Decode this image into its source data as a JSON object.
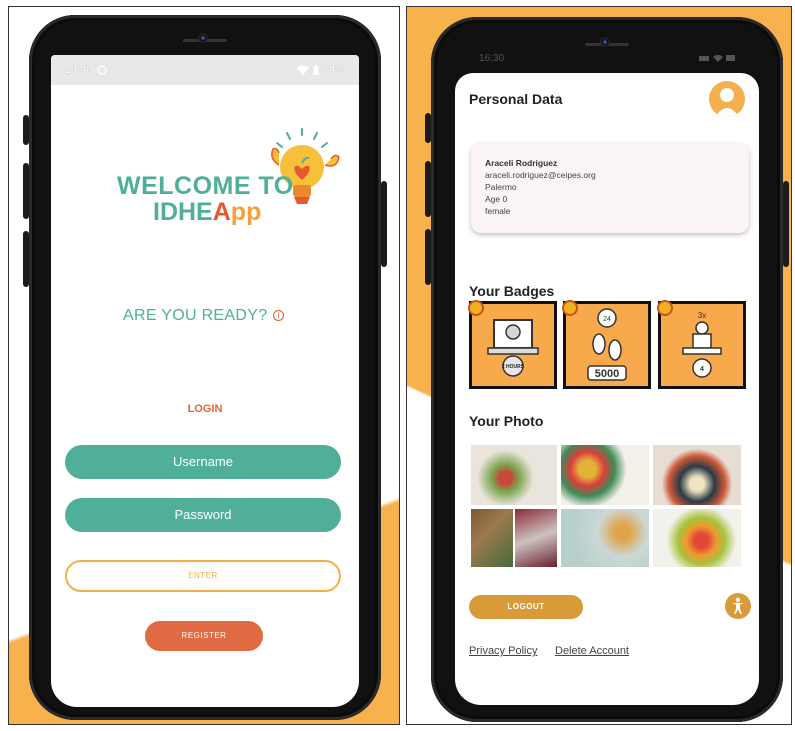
{
  "left_screen": {
    "status_time": "14:48",
    "status_battery": "84%",
    "welcome_line1": "WELCOME TO",
    "app_name_part1": "IDHE",
    "app_name_part2": "A",
    "app_name_part3": "pp",
    "ready_text": "ARE YOU READY?",
    "info_symbol": "i",
    "login_label": "LOGIN",
    "username_placeholder": "Username",
    "password_placeholder": "Password",
    "enter_label": "ENTER",
    "register_label": "REGISTER"
  },
  "right_screen": {
    "status_time": "16:30",
    "personal_data_title": "Personal Data",
    "profile": {
      "name": "Araceli Rodriguez",
      "email": "araceli.rodriguez@ceipes.org",
      "city": "Palermo",
      "age": "Age 0",
      "gender": "female"
    },
    "badges_title": "Your Badges",
    "badges": [
      {
        "icon": "computer-hours-badge-icon",
        "text": "2 HOURS"
      },
      {
        "icon": "steps-badge-icon",
        "text": "5000"
      },
      {
        "icon": "sitting-badge-icon",
        "text": "4"
      }
    ],
    "photos_title": "Your Photo",
    "logout_label": "LOGOUT",
    "privacy_label": "Privacy Policy",
    "delete_label": "Delete Account"
  },
  "colors": {
    "teal": "#4faf98",
    "orange": "#f7b24e",
    "red_orange": "#e06a42",
    "dark_gold": "#d99a3a"
  }
}
